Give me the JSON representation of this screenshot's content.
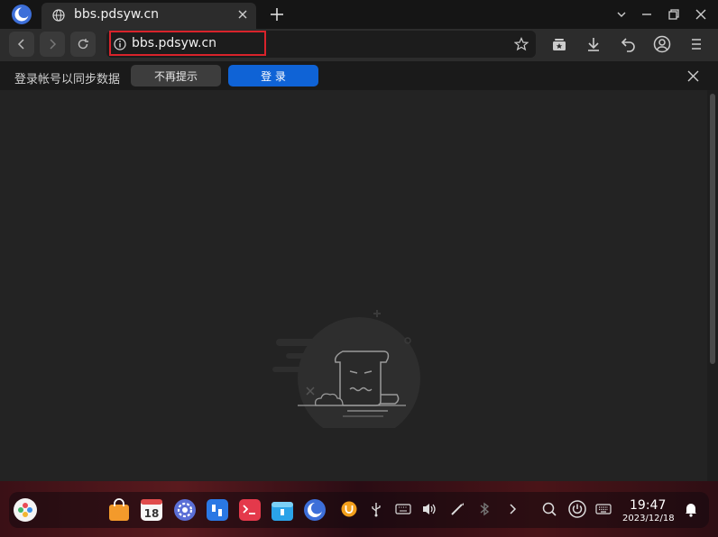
{
  "browser": {
    "tab_title": "bbs.pdsyw.cn",
    "url": "bbs.pdsyw.cn"
  },
  "infobar": {
    "message": "登录帐号以同步数据",
    "dismiss_label": "不再提示",
    "login_label": "登 录"
  },
  "taskbar": {
    "time": "19:47",
    "date": "2023/12/18",
    "calendar_day": "18"
  },
  "colors": {
    "accent": "#0f63d6",
    "highlight": "#d9232b",
    "background": "#232323"
  }
}
